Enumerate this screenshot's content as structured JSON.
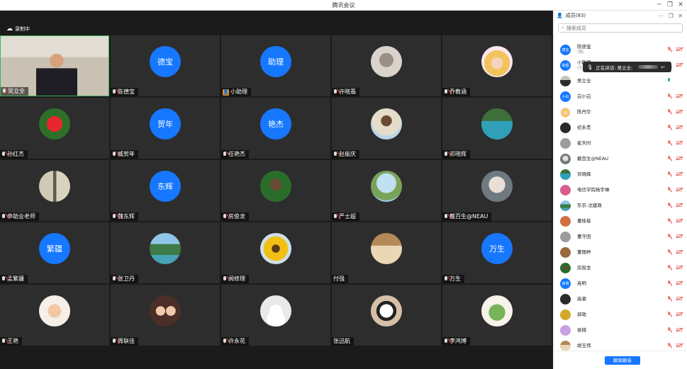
{
  "window": {
    "title": "腾讯会议"
  },
  "recording": {
    "label": "录制中"
  },
  "tiles": [
    {
      "name": "吴立全",
      "label": "",
      "type": "video"
    },
    {
      "name": "陈德宝",
      "label": "德宝",
      "type": "blue"
    },
    {
      "name": "小助理",
      "label": "助理",
      "type": "blue",
      "host": true
    },
    {
      "name": "许晓翡",
      "label": "",
      "type": "pic",
      "pic": "pic-cat"
    },
    {
      "name": "乔教涵",
      "label": "",
      "type": "pic",
      "pic": "pic-girl"
    },
    {
      "name": "孙红杰",
      "label": "",
      "type": "pic",
      "pic": "pic-flower"
    },
    {
      "name": "臧贺年",
      "label": "贺年",
      "type": "blue"
    },
    {
      "name": "任艳杰",
      "label": "艳杰",
      "type": "blue"
    },
    {
      "name": "赵振庆",
      "label": "",
      "type": "pic",
      "pic": "pic-kid"
    },
    {
      "name": "邓晓辉",
      "label": "",
      "type": "pic",
      "pic": "pic-lake"
    },
    {
      "name": "申助业老师",
      "label": "",
      "type": "pic",
      "pic": "pic-callig"
    },
    {
      "name": "魏东辉",
      "label": "东辉",
      "type": "blue"
    },
    {
      "name": "房俊龙",
      "label": "",
      "type": "pic",
      "pic": "pic-man"
    },
    {
      "name": "严士超",
      "label": "",
      "type": "pic",
      "pic": "pic-tree"
    },
    {
      "name": "戴百生@NEAU",
      "label": "",
      "type": "pic",
      "pic": "pic-doll"
    },
    {
      "name": "孟繁疆",
      "label": "繁疆",
      "type": "blue"
    },
    {
      "name": "张卫丹",
      "label": "",
      "type": "pic",
      "pic": "pic-mount"
    },
    {
      "name": "闻修理",
      "label": "",
      "type": "pic",
      "pic": "pic-sun"
    },
    {
      "name": "付强",
      "label": "",
      "type": "pic",
      "pic": "pic-room",
      "nomic": true
    },
    {
      "name": "万生",
      "label": "万生",
      "type": "blue"
    },
    {
      "name": "王艳",
      "label": "",
      "type": "pic",
      "pic": "pic-baby"
    },
    {
      "name": "周联佳",
      "label": "",
      "type": "pic",
      "pic": "pic-kids2"
    },
    {
      "name": "许永花",
      "label": "",
      "type": "pic",
      "pic": "pic-default"
    },
    {
      "name": "张迅航",
      "label": "",
      "type": "pic",
      "pic": "pic-panda",
      "nomic": true
    },
    {
      "name": "李鸿博",
      "label": "",
      "type": "pic",
      "pic": "pic-bear"
    }
  ],
  "panel": {
    "title": "成员(83)",
    "search_placeholder": "搜索成员",
    "speaking_text": "正在讲话: 吴立全;",
    "unmute_all": "解除静音",
    "members": [
      {
        "name": "陈德宝",
        "sub": "(我)",
        "avatar": "德宝",
        "pic": "blue",
        "mic": "off"
      },
      {
        "name": "小助理",
        "sub": "(主持人)",
        "avatar": "助理",
        "pic": "blue",
        "mic": "off"
      },
      {
        "name": "吴立全",
        "sub": "",
        "avatar": "",
        "pic": "pic-teacher",
        "mic": "on"
      },
      {
        "name": "白小白",
        "sub": "",
        "avatar": "小白",
        "pic": "blue",
        "mic": "off"
      },
      {
        "name": "陈丹华",
        "sub": "",
        "avatar": "",
        "pic": "pic-girl",
        "mic": "off"
      },
      {
        "name": "初永贵",
        "sub": "",
        "avatar": "",
        "pic": "pic-dark",
        "mic": "off"
      },
      {
        "name": "崔天时",
        "sub": "",
        "avatar": "",
        "pic": "pic-gray",
        "mic": "off"
      },
      {
        "name": "戴百生@NEAU",
        "sub": "",
        "avatar": "",
        "pic": "pic-doll",
        "mic": "off"
      },
      {
        "name": "邓晓辉",
        "sub": "",
        "avatar": "",
        "pic": "pic-lake",
        "mic": "off"
      },
      {
        "name": "电信学院杨宇琳",
        "sub": "",
        "avatar": "",
        "pic": "pic-pink",
        "mic": "off"
      },
      {
        "name": "东农-沈建政",
        "sub": "",
        "avatar": "",
        "pic": "pic-mount",
        "mic": "off"
      },
      {
        "name": "董桂菊",
        "sub": "",
        "avatar": "",
        "pic": "pic-orange",
        "mic": "off"
      },
      {
        "name": "董守田",
        "sub": "",
        "avatar": "",
        "pic": "pic-gray",
        "mic": "off"
      },
      {
        "name": "董丽婷",
        "sub": "",
        "avatar": "",
        "pic": "pic-brown",
        "mic": "off"
      },
      {
        "name": "房俊龙",
        "sub": "",
        "avatar": "",
        "pic": "pic-man",
        "mic": "off"
      },
      {
        "name": "高明",
        "sub": "",
        "avatar": "高明",
        "pic": "blue",
        "mic": "off"
      },
      {
        "name": "高睿",
        "sub": "",
        "avatar": "",
        "pic": "pic-dark",
        "mic": "off"
      },
      {
        "name": "郭政",
        "sub": "",
        "avatar": "",
        "pic": "pic-yellow",
        "mic": "off"
      },
      {
        "name": "侯微",
        "sub": "",
        "avatar": "",
        "pic": "pic-purple",
        "mic": "off"
      },
      {
        "name": "胡玉伟",
        "sub": "",
        "avatar": "",
        "pic": "pic-room",
        "mic": "off"
      }
    ]
  }
}
